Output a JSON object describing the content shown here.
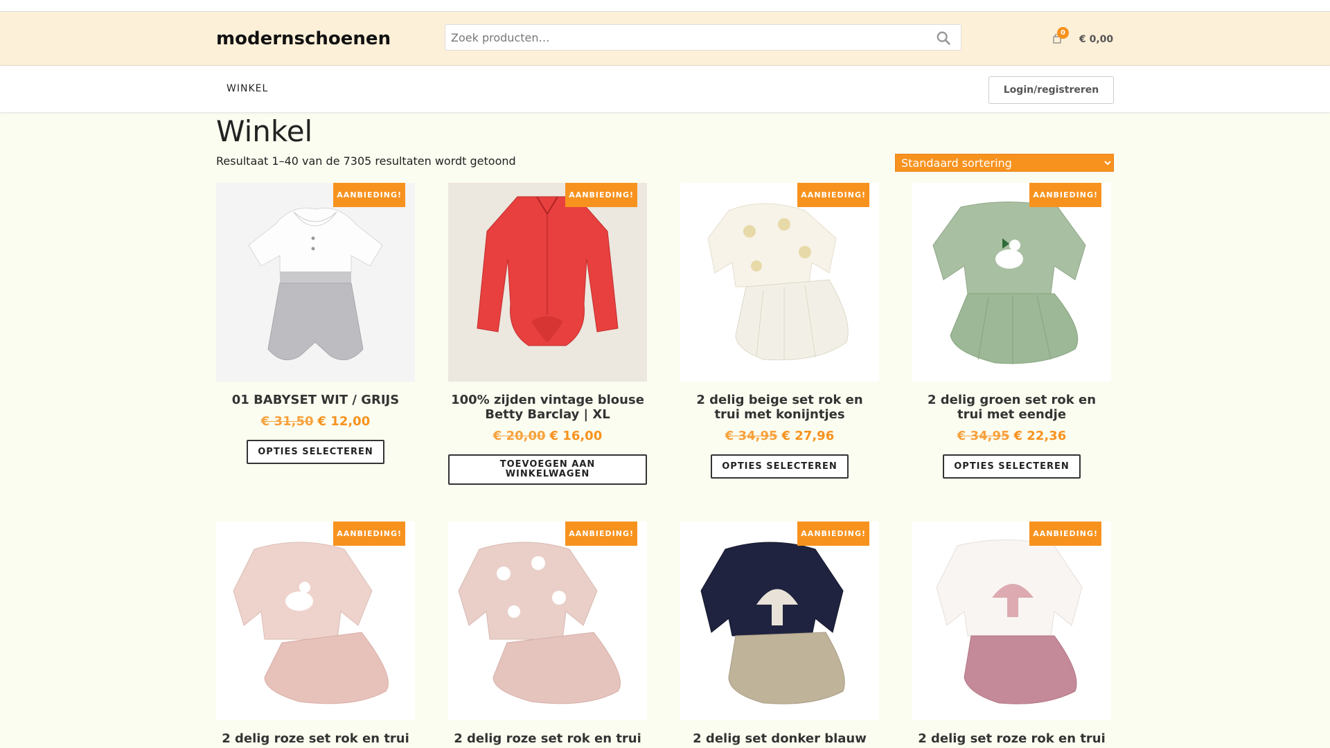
{
  "header": {
    "logo": "modernschoenen",
    "search_placeholder": "Zoek producten…",
    "cart_count": "0",
    "cart_total": "€ 0,00"
  },
  "nav": {
    "items": [
      {
        "label": "WINKEL"
      }
    ],
    "login_label": "Login/registreren"
  },
  "main": {
    "title": "Winkel",
    "result_count": "Resultaat 1–40 van de 7305 resultaten wordt getoond",
    "sort_selected": "Standaard sortering"
  },
  "products": [
    {
      "name": "01 BABYSET WIT / GRIJS",
      "old_price": "€ 31,50",
      "price": "€ 12,00",
      "badge": "AANBIEDING!",
      "button": "OPTIES SELECTEREN"
    },
    {
      "name": "100% zijden vintage blouse Betty Barclay | XL",
      "old_price": "€ 20,00",
      "price": "€ 16,00",
      "badge": "AANBIEDING!",
      "button": "TOEVOEGEN AAN WINKELWAGEN"
    },
    {
      "name": "2 delig beige set rok en trui met konijntjes",
      "old_price": "€ 34,95",
      "price": "€ 27,96",
      "badge": "AANBIEDING!",
      "button": "OPTIES SELECTEREN"
    },
    {
      "name": "2 delig groen set rok en trui met eendje",
      "old_price": "€ 34,95",
      "price": "€ 22,36",
      "badge": "AANBIEDING!",
      "button": "OPTIES SELECTEREN"
    },
    {
      "name": "2 delig roze set rok en trui",
      "badge": "AANBIEDING!"
    },
    {
      "name": "2 delig roze set rok en trui",
      "badge": "AANBIEDING!"
    },
    {
      "name": "2 delig set donker blauw",
      "badge": "AANBIEDING!"
    },
    {
      "name": "2 delig set roze rok en trui",
      "badge": "AANBIEDING!"
    }
  ],
  "colors": {
    "accent": "#f7921e",
    "header_bg": "#fdf0d8",
    "page_bg": "#fbfdf0"
  }
}
